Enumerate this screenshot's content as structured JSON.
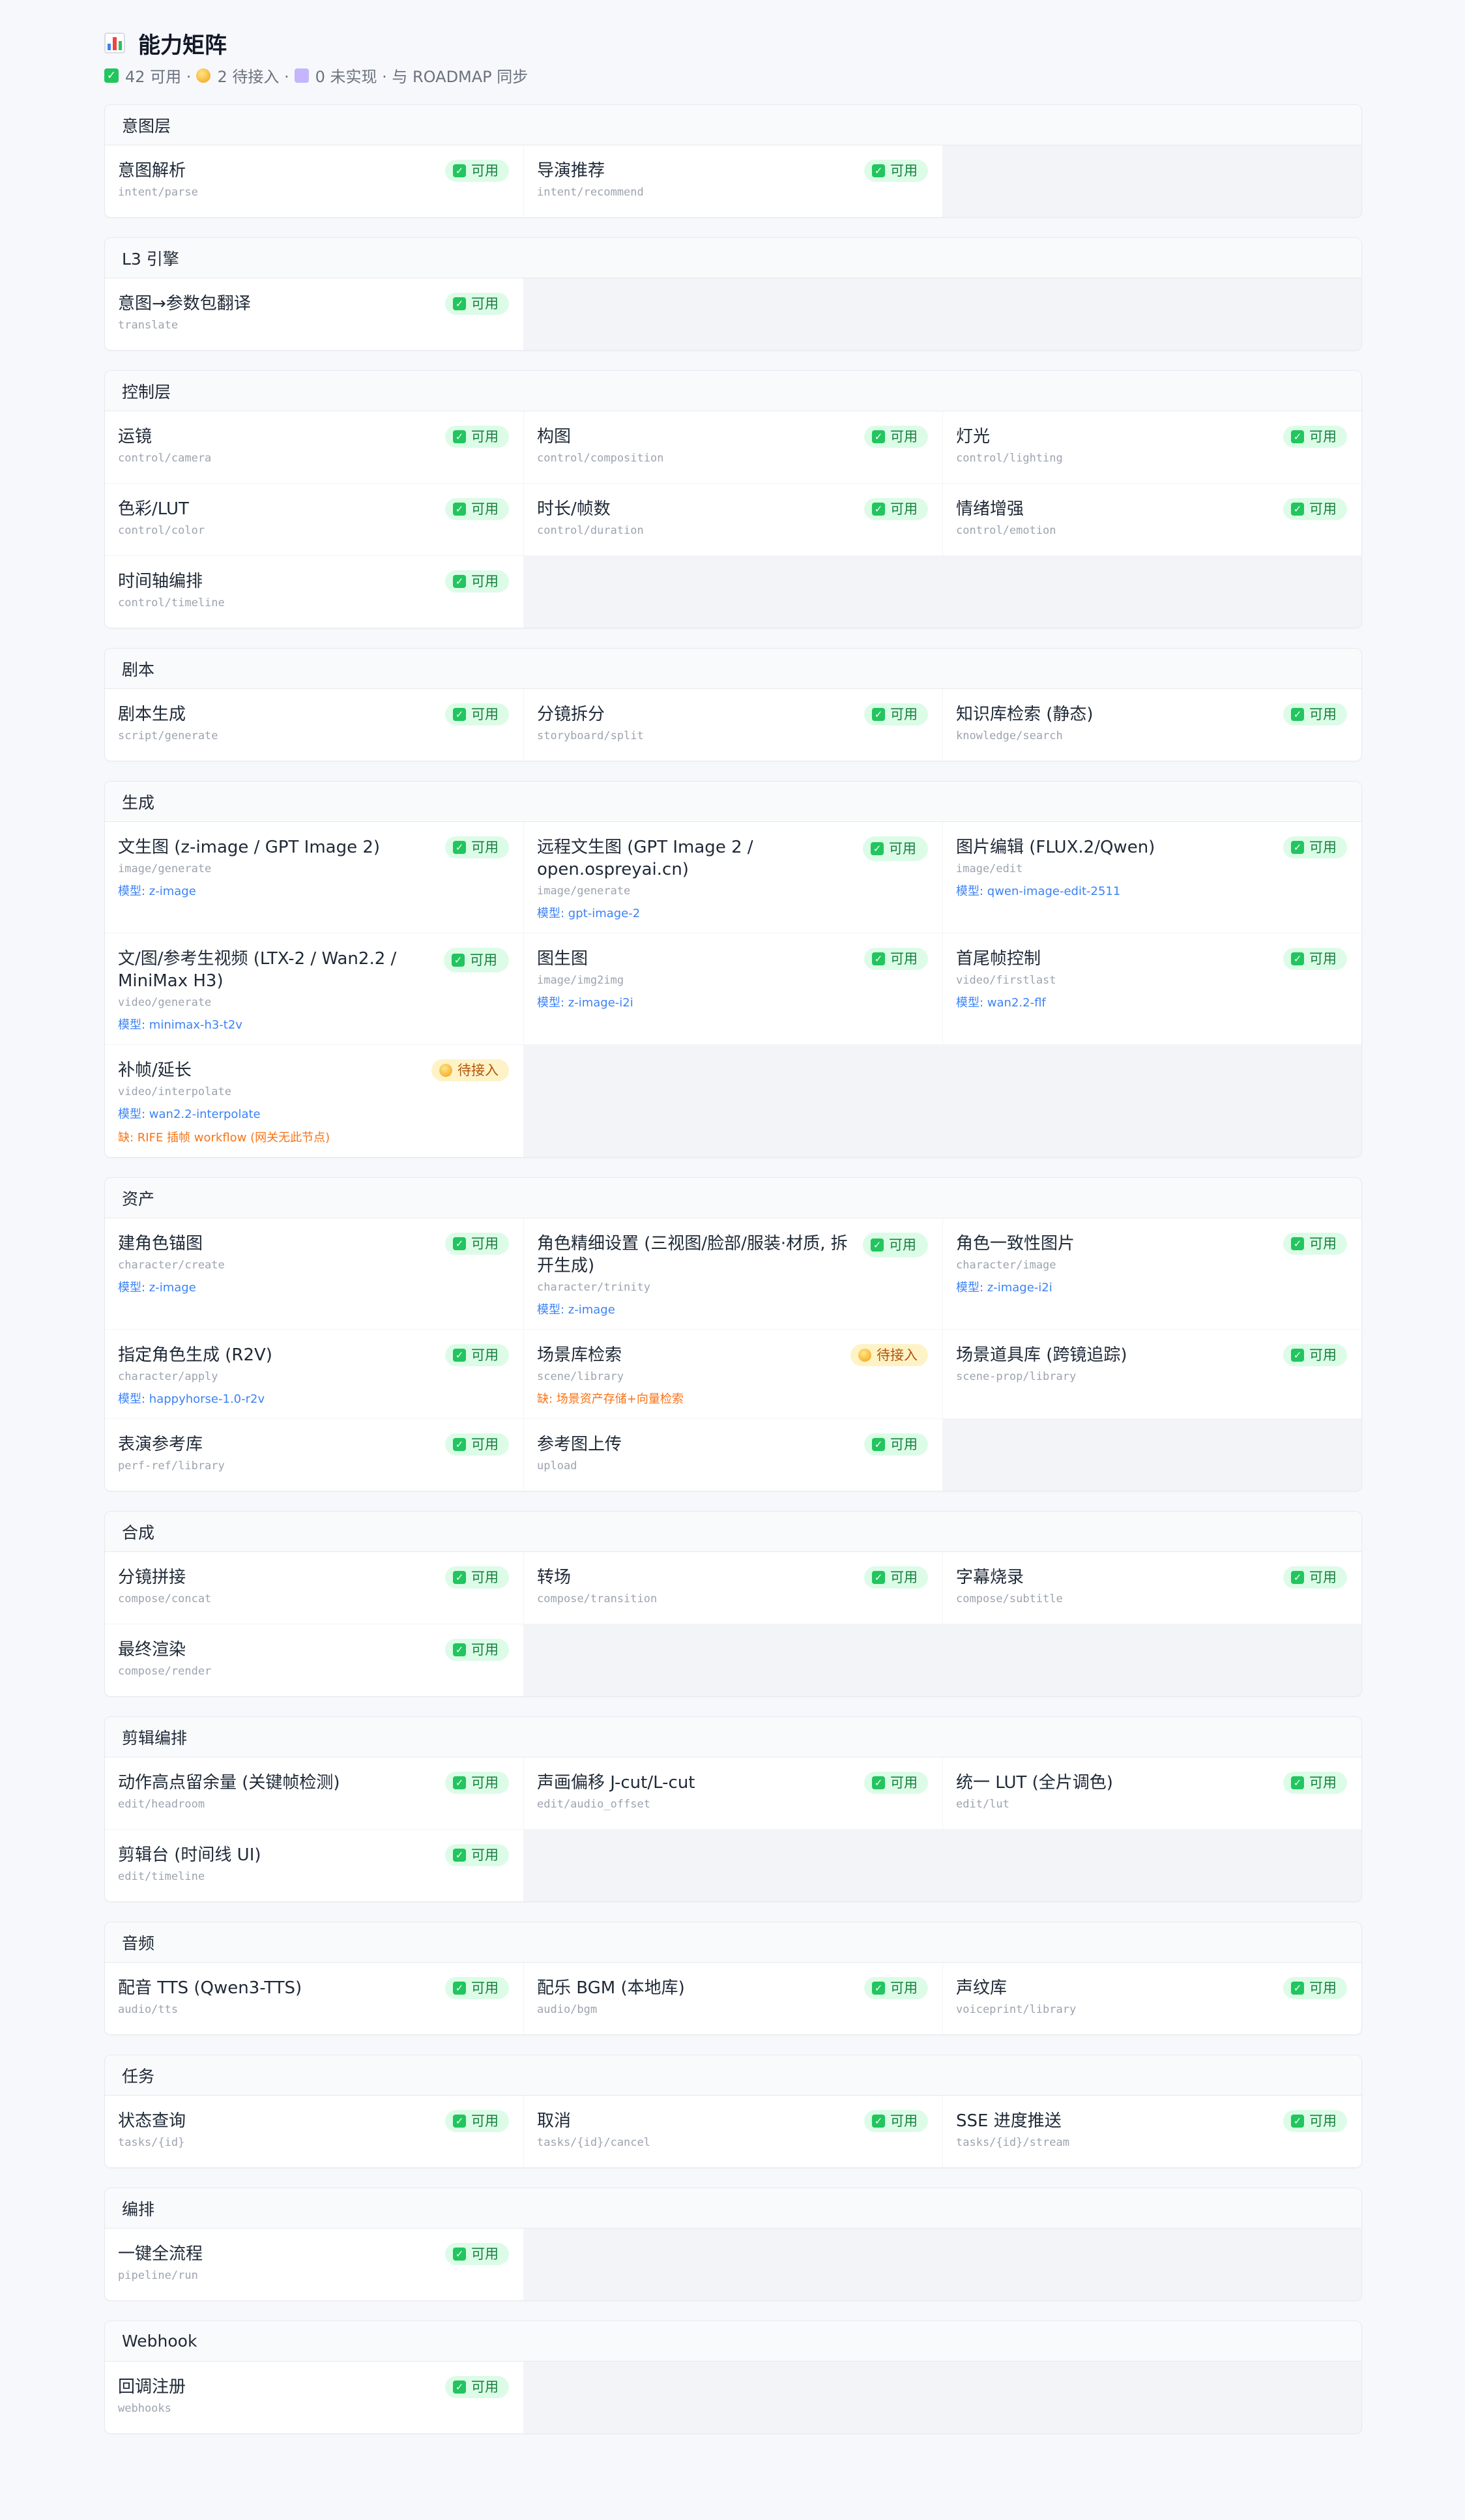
{
  "header": {
    "title": "能力矩阵",
    "summary": {
      "available_text": "42 可用 ·",
      "pending_text": "2 待接入 ·",
      "missing_text": "0 未实现 · 与 ROADMAP 同步"
    }
  },
  "labels": {
    "available": "可用",
    "pending": "待接入"
  },
  "sections": [
    {
      "title": "意图层",
      "items": [
        {
          "name": "意图解析",
          "path": "intent/parse",
          "status": "available"
        },
        {
          "name": "导演推荐",
          "path": "intent/recommend",
          "status": "available"
        }
      ]
    },
    {
      "title": "L3 引擎",
      "items": [
        {
          "name": "意图→参数包翻译",
          "path": "translate",
          "status": "available"
        }
      ]
    },
    {
      "title": "控制层",
      "items": [
        {
          "name": "运镜",
          "path": "control/camera",
          "status": "available"
        },
        {
          "name": "构图",
          "path": "control/composition",
          "status": "available"
        },
        {
          "name": "灯光",
          "path": "control/lighting",
          "status": "available"
        },
        {
          "name": "色彩/LUT",
          "path": "control/color",
          "status": "available"
        },
        {
          "name": "时长/帧数",
          "path": "control/duration",
          "status": "available"
        },
        {
          "name": "情绪增强",
          "path": "control/emotion",
          "status": "available"
        },
        {
          "name": "时间轴编排",
          "path": "control/timeline",
          "status": "available"
        }
      ]
    },
    {
      "title": "剧本",
      "items": [
        {
          "name": "剧本生成",
          "path": "script/generate",
          "status": "available"
        },
        {
          "name": "分镜拆分",
          "path": "storyboard/split",
          "status": "available"
        },
        {
          "name": "知识库检索 (静态)",
          "path": "knowledge/search",
          "status": "available"
        }
      ]
    },
    {
      "title": "生成",
      "items": [
        {
          "name": "文生图 (z-image / GPT Image 2)",
          "path": "image/generate",
          "model": "模型: z-image",
          "status": "available"
        },
        {
          "name": "远程文生图 (GPT Image 2 / open.ospreyai.cn)",
          "path": "image/generate",
          "model": "模型: gpt-image-2",
          "status": "available",
          "narrow": true
        },
        {
          "name": "图片编辑 (FLUX.2/Qwen)",
          "path": "image/edit",
          "model": "模型: qwen-image-edit-2511",
          "status": "available"
        },
        {
          "name": "文/图/参考生视频 (LTX-2 / Wan2.2 / MiniMax H3)",
          "path": "video/generate",
          "model": "模型: minimax-h3-t2v",
          "status": "available",
          "narrow": true
        },
        {
          "name": "图生图",
          "path": "image/img2img",
          "model": "模型: z-image-i2i",
          "status": "available"
        },
        {
          "name": "首尾帧控制",
          "path": "video/firstlast",
          "model": "模型: wan2.2-flf",
          "status": "available"
        },
        {
          "name": "补帧/延长",
          "path": "video/interpolate",
          "model": "模型: wan2.2-interpolate",
          "missing": "缺: RIFE 插帧 workflow (网关无此节点)",
          "status": "pending"
        }
      ]
    },
    {
      "title": "资产",
      "items": [
        {
          "name": "建角色锚图",
          "path": "character/create",
          "model": "模型: z-image",
          "status": "available"
        },
        {
          "name": "角色精细设置 (三视图/脸部/服装·材质, 拆开生成)",
          "path": "character/trinity",
          "model": "模型: z-image",
          "status": "available",
          "narrow": true
        },
        {
          "name": "角色一致性图片",
          "path": "character/image",
          "model": "模型: z-image-i2i",
          "status": "available"
        },
        {
          "name": "指定角色生成 (R2V)",
          "path": "character/apply",
          "model": "模型: happyhorse-1.0-r2v",
          "status": "available"
        },
        {
          "name": "场景库检索",
          "path": "scene/library",
          "missing": "缺: 场景资产存储+向量检索",
          "status": "pending"
        },
        {
          "name": "场景道具库 (跨镜追踪)",
          "path": "scene-prop/library",
          "status": "available"
        },
        {
          "name": "表演参考库",
          "path": "perf-ref/library",
          "status": "available"
        },
        {
          "name": "参考图上传",
          "path": "upload",
          "status": "available"
        }
      ]
    },
    {
      "title": "合成",
      "items": [
        {
          "name": "分镜拼接",
          "path": "compose/concat",
          "status": "available"
        },
        {
          "name": "转场",
          "path": "compose/transition",
          "status": "available"
        },
        {
          "name": "字幕烧录",
          "path": "compose/subtitle",
          "status": "available"
        },
        {
          "name": "最终渲染",
          "path": "compose/render",
          "status": "available"
        }
      ]
    },
    {
      "title": "剪辑编排",
      "items": [
        {
          "name": "动作高点留余量 (关键帧检测)",
          "path": "edit/headroom",
          "status": "available"
        },
        {
          "name": "声画偏移 J-cut/L-cut",
          "path": "edit/audio_offset",
          "status": "available"
        },
        {
          "name": "统一 LUT (全片调色)",
          "path": "edit/lut",
          "status": "available"
        },
        {
          "name": "剪辑台 (时间线 UI)",
          "path": "edit/timeline",
          "status": "available"
        }
      ]
    },
    {
      "title": "音频",
      "items": [
        {
          "name": "配音 TTS (Qwen3-TTS)",
          "path": "audio/tts",
          "status": "available"
        },
        {
          "name": "配乐 BGM (本地库)",
          "path": "audio/bgm",
          "status": "available"
        },
        {
          "name": "声纹库",
          "path": "voiceprint/library",
          "status": "available"
        }
      ]
    },
    {
      "title": "任务",
      "items": [
        {
          "name": "状态查询",
          "path": "tasks/{id}",
          "status": "available"
        },
        {
          "name": "取消",
          "path": "tasks/{id}/cancel",
          "status": "available"
        },
        {
          "name": "SSE 进度推送",
          "path": "tasks/{id}/stream",
          "status": "available"
        }
      ]
    },
    {
      "title": "编排",
      "items": [
        {
          "name": "一键全流程",
          "path": "pipeline/run",
          "status": "available"
        }
      ]
    },
    {
      "title": "Webhook",
      "items": [
        {
          "name": "回调注册",
          "path": "webhooks",
          "status": "available"
        }
      ]
    }
  ]
}
